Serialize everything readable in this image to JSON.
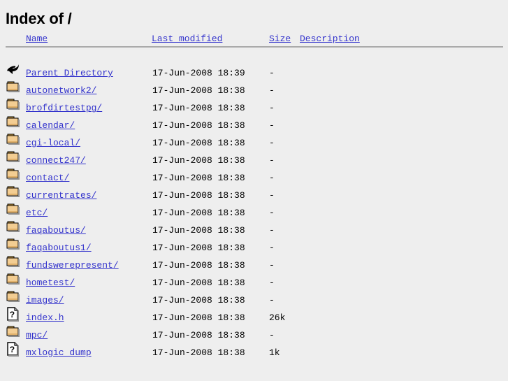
{
  "page": {
    "title": "Index of /",
    "background_color": "#eeeeee",
    "link_color": "#3333cc",
    "text_color": "#000000",
    "rule_color": "#aaaaaa"
  },
  "columns": {
    "icon": "",
    "name": "Name",
    "last_modified": "Last modified",
    "size": "Size",
    "description": "Description"
  },
  "entries": [
    {
      "icon": "back-arrow-icon",
      "name": "Parent Directory",
      "last_modified": "17-Jun-2008 18:39",
      "size": "-",
      "description": ""
    },
    {
      "icon": "folder-icon",
      "name": "autonetwork2/",
      "last_modified": "17-Jun-2008 18:38",
      "size": "-",
      "description": ""
    },
    {
      "icon": "folder-icon",
      "name": "brofdirtestpg/",
      "last_modified": "17-Jun-2008 18:38",
      "size": "-",
      "description": ""
    },
    {
      "icon": "folder-icon",
      "name": "calendar/",
      "last_modified": "17-Jun-2008 18:38",
      "size": "-",
      "description": ""
    },
    {
      "icon": "folder-icon",
      "name": "cgi-local/",
      "last_modified": "17-Jun-2008 18:38",
      "size": "-",
      "description": ""
    },
    {
      "icon": "folder-icon",
      "name": "connect247/",
      "last_modified": "17-Jun-2008 18:38",
      "size": "-",
      "description": ""
    },
    {
      "icon": "folder-icon",
      "name": "contact/",
      "last_modified": "17-Jun-2008 18:38",
      "size": "-",
      "description": ""
    },
    {
      "icon": "folder-icon",
      "name": "currentrates/",
      "last_modified": "17-Jun-2008 18:38",
      "size": "-",
      "description": ""
    },
    {
      "icon": "folder-icon",
      "name": "etc/",
      "last_modified": "17-Jun-2008 18:38",
      "size": "-",
      "description": ""
    },
    {
      "icon": "folder-icon",
      "name": "faqaboutus/",
      "last_modified": "17-Jun-2008 18:38",
      "size": "-",
      "description": ""
    },
    {
      "icon": "folder-icon",
      "name": "faqaboutus1/",
      "last_modified": "17-Jun-2008 18:38",
      "size": "-",
      "description": ""
    },
    {
      "icon": "folder-icon",
      "name": "fundswerepresent/",
      "last_modified": "17-Jun-2008 18:38",
      "size": "-",
      "description": ""
    },
    {
      "icon": "folder-icon",
      "name": "hometest/",
      "last_modified": "17-Jun-2008 18:38",
      "size": "-",
      "description": ""
    },
    {
      "icon": "folder-icon",
      "name": "images/",
      "last_modified": "17-Jun-2008 18:38",
      "size": "-",
      "description": ""
    },
    {
      "icon": "unknown-file-icon",
      "name": "index.h",
      "last_modified": "17-Jun-2008 18:38",
      "size": "26k",
      "description": ""
    },
    {
      "icon": "folder-icon",
      "name": "mpc/",
      "last_modified": "17-Jun-2008 18:38",
      "size": "-",
      "description": ""
    },
    {
      "icon": "unknown-file-icon",
      "name": "mxlogic_dump",
      "last_modified": "17-Jun-2008 18:38",
      "size": "1k",
      "description": ""
    }
  ]
}
